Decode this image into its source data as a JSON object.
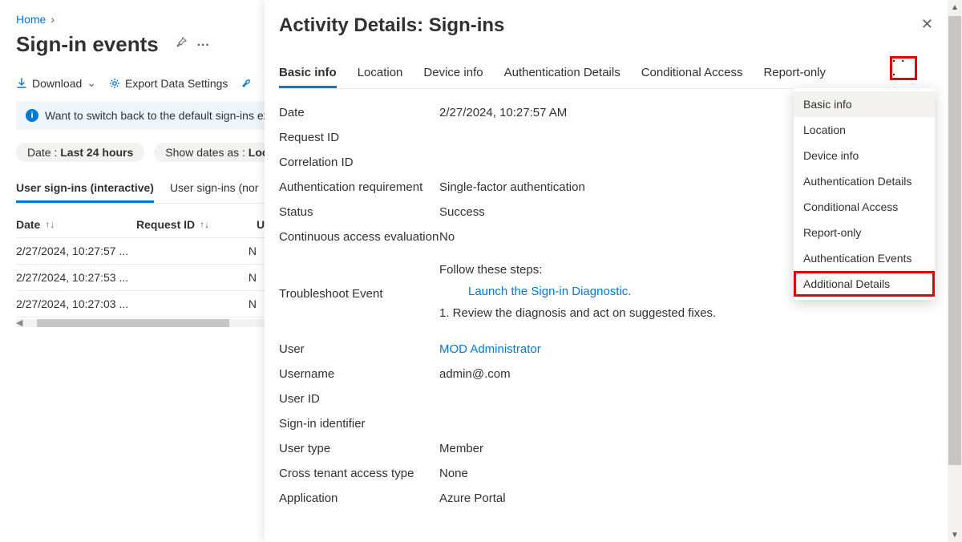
{
  "breadcrumb": {
    "home": "Home"
  },
  "page": {
    "title": "Sign-in events"
  },
  "toolbar": {
    "download": "Download",
    "export": "Export Data Settings"
  },
  "banner": {
    "text": "Want to switch back to the default sign-ins experi"
  },
  "filters": {
    "date_label": "Date :",
    "date_value": "Last 24 hours",
    "show_label": "Show dates as :",
    "show_value": "Loca"
  },
  "subtabs": {
    "interactive": "User sign-ins (interactive)",
    "noninteractive": "User sign-ins (nor"
  },
  "grid": {
    "headers": {
      "date": "Date",
      "request": "Request ID",
      "u": "U"
    },
    "rows": [
      {
        "date": "2/27/2024, 10:27:57 ...",
        "n": "N"
      },
      {
        "date": "2/27/2024, 10:27:53 ...",
        "n": "N"
      },
      {
        "date": "2/27/2024, 10:27:03 ...",
        "n": "N"
      }
    ]
  },
  "panel": {
    "title": "Activity Details: Sign-ins",
    "tabs": {
      "basic": "Basic info",
      "location": "Location",
      "device": "Device info",
      "auth": "Authentication Details",
      "ca": "Conditional Access",
      "report": "Report-only"
    },
    "fields": {
      "date_l": "Date",
      "date_v": "2/27/2024, 10:27:57 AM",
      "request_l": "Request ID",
      "request_v": "",
      "corr_l": "Correlation ID",
      "corr_v": "",
      "authreq_l": "Authentication requirement",
      "authreq_v": "Single-factor authentication",
      "status_l": "Status",
      "status_v": "Success",
      "cae_l": "Continuous access evaluation",
      "cae_v": "No",
      "trouble_l": "Troubleshoot Event",
      "follow": "Follow these steps:",
      "launch": "Launch the Sign-in Diagnostic.",
      "step1": "1. Review the diagnosis and act on suggested fixes.",
      "user_l": "User",
      "user_v": "MOD Administrator",
      "username_l": "Username",
      "username_v": "admin@.com",
      "userid_l": "User ID",
      "userid_v": "",
      "signinid_l": "Sign-in identifier",
      "signinid_v": "",
      "usertype_l": "User type",
      "usertype_v": "Member",
      "cross_l": "Cross tenant access type",
      "cross_v": "None",
      "app_l": "Application",
      "app_v": "Azure Portal"
    }
  },
  "dropdown": {
    "items": [
      "Basic info",
      "Location",
      "Device info",
      "Authentication Details",
      "Conditional Access",
      "Report-only",
      "Authentication Events",
      "Additional Details"
    ]
  }
}
